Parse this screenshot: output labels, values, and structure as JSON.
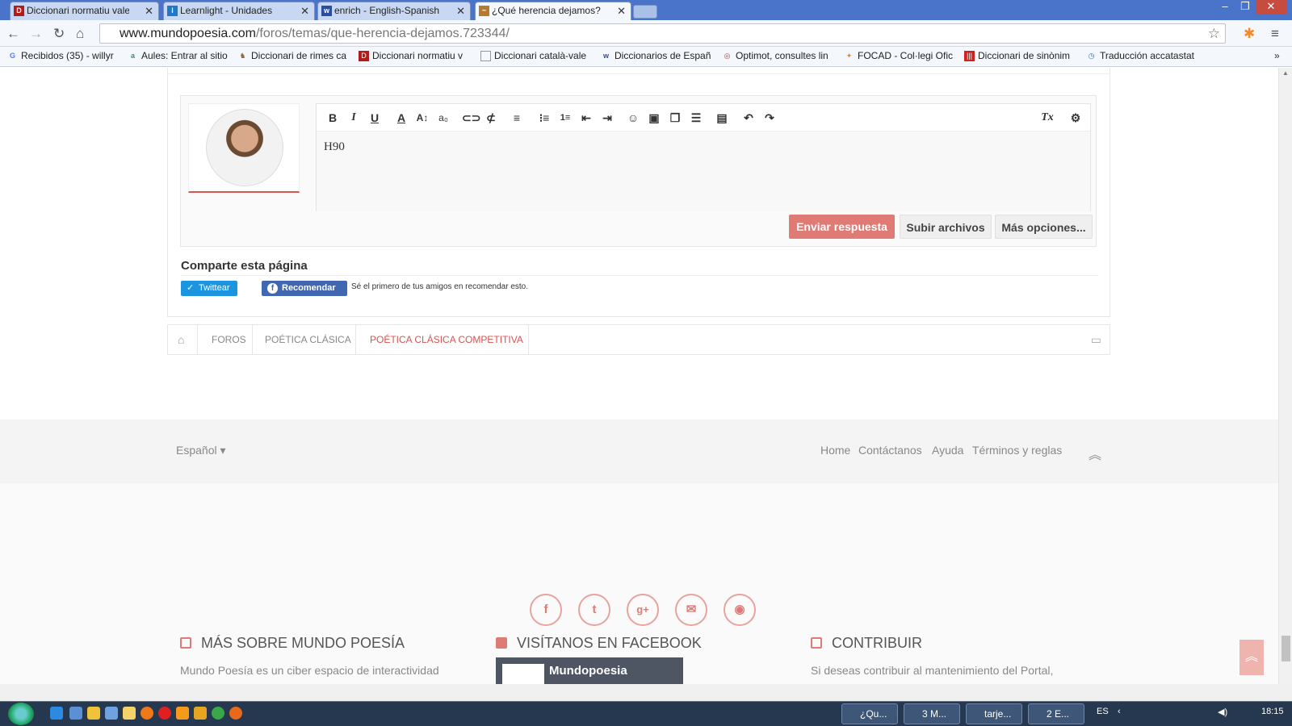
{
  "browser": {
    "tabs": [
      {
        "label": "Diccionari normatiu valen",
        "icon": "dnv-icon",
        "color": "#b31b1b"
      },
      {
        "label": "Learnlight - Unidades",
        "icon": "learnlight-icon",
        "color": "#1f7ac4"
      },
      {
        "label": "enrich - English-Spanish D",
        "icon": "wordreference-icon",
        "color": "#2a4fa0"
      },
      {
        "label": "¿Qué herencia dejamos? |",
        "icon": "mundopoesia-icon",
        "color": "#b57a2b"
      }
    ],
    "url_domain": "www.mundopoesia.com",
    "url_path": "/foros/temas/que-herencia-dejamos.723344/",
    "bookmarks": [
      "Recibidos (35) - willyr",
      "Aules: Entrar al sitio",
      "Diccionari de rimes ca",
      "Diccionari normatiu v",
      "Diccionari català-vale",
      "Diccionarios de Españ",
      "Optimot, consultes lin",
      "FOCAD - Col·legi Ofic",
      "Diccionari de sinònim",
      "Traducción accatastat"
    ]
  },
  "editor": {
    "content": "H90",
    "buttons": {
      "submit": "Enviar respuesta",
      "upload": "Subir archivos",
      "more": "Más opciones..."
    }
  },
  "share": {
    "title": "Comparte esta página",
    "twitter": "Twittear",
    "facebook": "Recomendar",
    "facebook_note": "Sé el primero de tus amigos en recomendar esto."
  },
  "breadcrumb": {
    "items": [
      "FOROS",
      "POÉTICA CLÁSICA",
      "POÉTICA CLÁSICA COMPETITIVA"
    ]
  },
  "footer": {
    "language": "Español",
    "links": [
      "Home",
      "Contáctanos",
      "Ayuda",
      "Términos y reglas"
    ],
    "sections": [
      {
        "title": "MÁS SOBRE MUNDO POESÍA",
        "text": "Mundo Poesía es un ciber espacio de interactividad"
      },
      {
        "title": "VISÍTANOS EN FACEBOOK",
        "widget_name": "Mundopoesia"
      },
      {
        "title": "CONTRIBUIR",
        "text": "Si deseas contribuir al mantenimiento del Portal,"
      }
    ]
  },
  "taskbar": {
    "tasks": [
      "¿Qu...",
      "3 M...",
      "tarje...",
      "2 E..."
    ],
    "lang": "ES",
    "time": "18:15"
  },
  "colors": {
    "accent": "#e07a74",
    "twitter": "#1b95e0",
    "facebook": "#4267b2"
  }
}
